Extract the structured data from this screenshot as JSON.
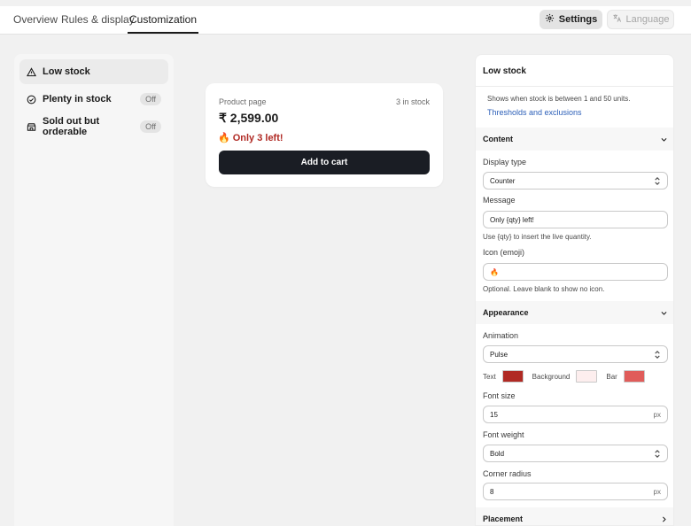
{
  "tabs": [
    {
      "label": "Overview"
    },
    {
      "label": "Rules & display"
    },
    {
      "label": "Customization"
    }
  ],
  "toolbar": {
    "settings_label": "Settings",
    "language_label": "Language"
  },
  "states": [
    {
      "label": "Low stock",
      "icon": "warning-icon",
      "badge": ""
    },
    {
      "label": "Plenty in stock",
      "icon": "check-circle-icon",
      "badge": "Off"
    },
    {
      "label": "Sold out but orderable",
      "icon": "store-icon",
      "badge": "Off"
    }
  ],
  "preview": {
    "page_label": "Product page",
    "stock_label": "3 in stock",
    "price": "₹ 2,599.00",
    "message": "Only 3 left!",
    "message_icon": "🔥",
    "cart_label": "Add to cart"
  },
  "panel": {
    "title": "Low stock",
    "description": "Shows when stock is between 1 and 50 units.",
    "link": "Thresholds and exclusions",
    "content": {
      "title": "Content",
      "display_type_label": "Display type",
      "display_type_value": "Counter",
      "message_label": "Message",
      "message_value": "Only {qty} left!",
      "message_hint": "Use {qty} to insert the live quantity.",
      "icon_label": "Icon (emoji)",
      "icon_value": "🔥",
      "icon_hint": "Optional. Leave blank to show no icon."
    },
    "appearance": {
      "title": "Appearance",
      "animation_label": "Animation",
      "animation_value": "Pulse",
      "text_label": "Text",
      "text_color": "#b02a24",
      "background_label": "Background",
      "background_color": "#fdeeee",
      "bar_label": "Bar",
      "bar_color": "#e05c5a",
      "font_size_label": "Font size",
      "font_size_value": "15",
      "font_size_unit": "px",
      "font_weight_label": "Font weight",
      "font_weight_value": "Bold",
      "corner_radius_label": "Corner radius",
      "corner_radius_value": "8",
      "corner_radius_unit": "px"
    },
    "placement": {
      "title": "Placement"
    }
  }
}
